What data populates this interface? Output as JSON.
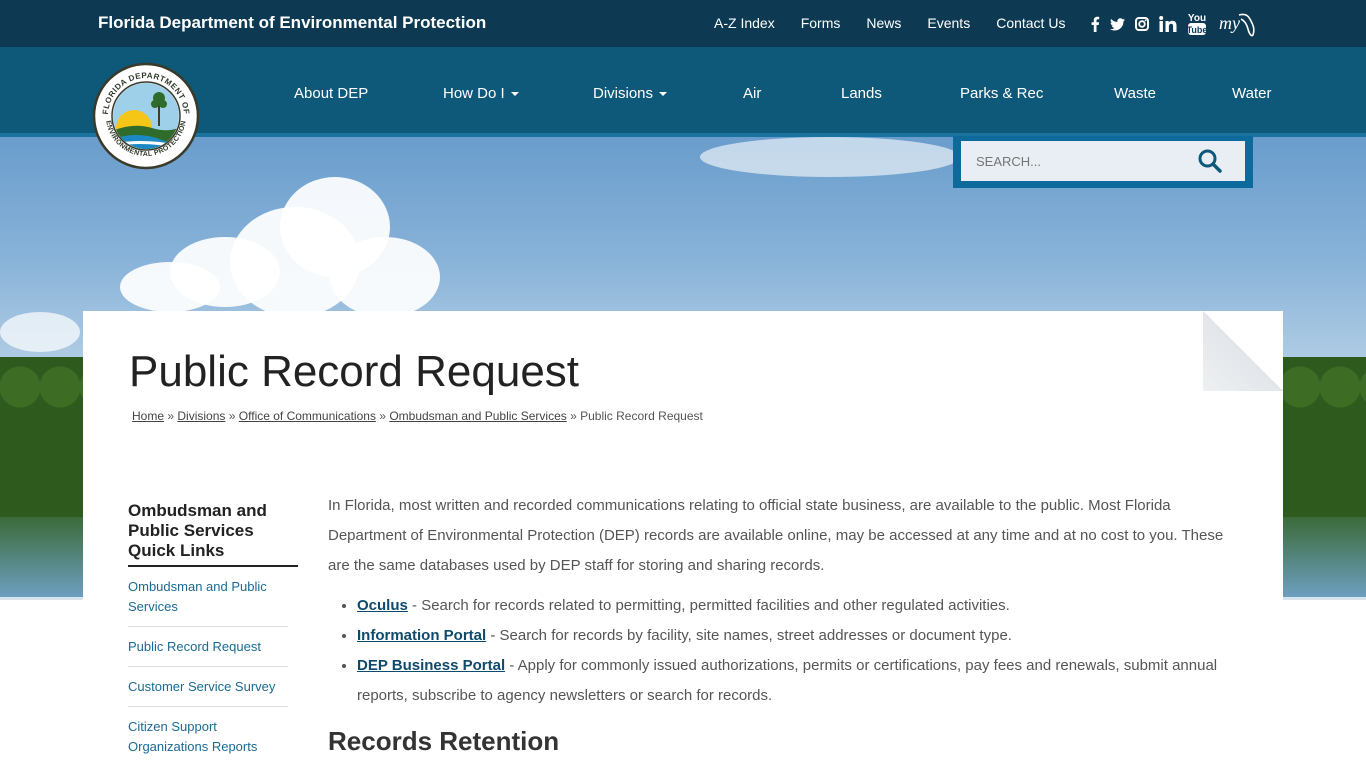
{
  "header": {
    "site_title": "Florida Department of Environmental Protection",
    "utility_nav": [
      "A-Z Index",
      "Forms",
      "News",
      "Events",
      "Contact Us"
    ],
    "social_icons": [
      "facebook-icon",
      "twitter-icon",
      "instagram-icon",
      "linkedin-icon",
      "youtube-icon",
      "myflorida-icon"
    ]
  },
  "main_nav": {
    "items": [
      {
        "label": "About DEP",
        "dropdown": false
      },
      {
        "label": "How Do I",
        "dropdown": true
      },
      {
        "label": "Divisions",
        "dropdown": true
      },
      {
        "label": "Air",
        "dropdown": false
      },
      {
        "label": "Lands",
        "dropdown": false
      },
      {
        "label": "Parks & Rec",
        "dropdown": false
      },
      {
        "label": "Waste",
        "dropdown": false
      },
      {
        "label": "Water",
        "dropdown": false
      }
    ]
  },
  "logo": {
    "text": "FLORIDA DEPARTMENT OF ENVIRONMENTAL PROTECTION"
  },
  "search": {
    "placeholder": "SEARCH..."
  },
  "page": {
    "title": "Public Record Request",
    "breadcrumb": [
      "Home",
      "Divisions",
      "Office of Communications",
      "Ombudsman and Public Services"
    ],
    "breadcrumb_current": "Public Record Request",
    "breadcrumb_separator": "»"
  },
  "sidebar": {
    "title": "Ombudsman and Public Services Quick Links",
    "links": [
      "Ombudsman and Public Services",
      "Public Record Request",
      "Customer Service Survey",
      "Citizen Support Organizations Reports"
    ]
  },
  "content": {
    "intro": "In Florida, most written and recorded communications relating to official state business, are available to the public. Most Florida Department of Environmental Protection (DEP) records are available online, may be accessed at any time and at no cost to you. These are the same databases used by DEP staff for storing and sharing records.",
    "list": [
      {
        "link": "Oculus",
        "text": " - Search for records related to permitting, permitted facilities and other regulated activities."
      },
      {
        "link": "Information Portal",
        "text": " - Search for records by facility, site names, street addresses or document type."
      },
      {
        "link": "DEP Business Portal",
        "text": " - Apply for commonly issued authorizations, permits or certifications, pay fees and renewals, submit annual reports, subscribe to agency newsletters or search for records."
      }
    ],
    "heading2": "Records Retention"
  },
  "colors": {
    "topbar": "#0d3a52",
    "mainbar": "#0e587a",
    "accent": "#1b74a0",
    "link": "#1a6a93"
  }
}
